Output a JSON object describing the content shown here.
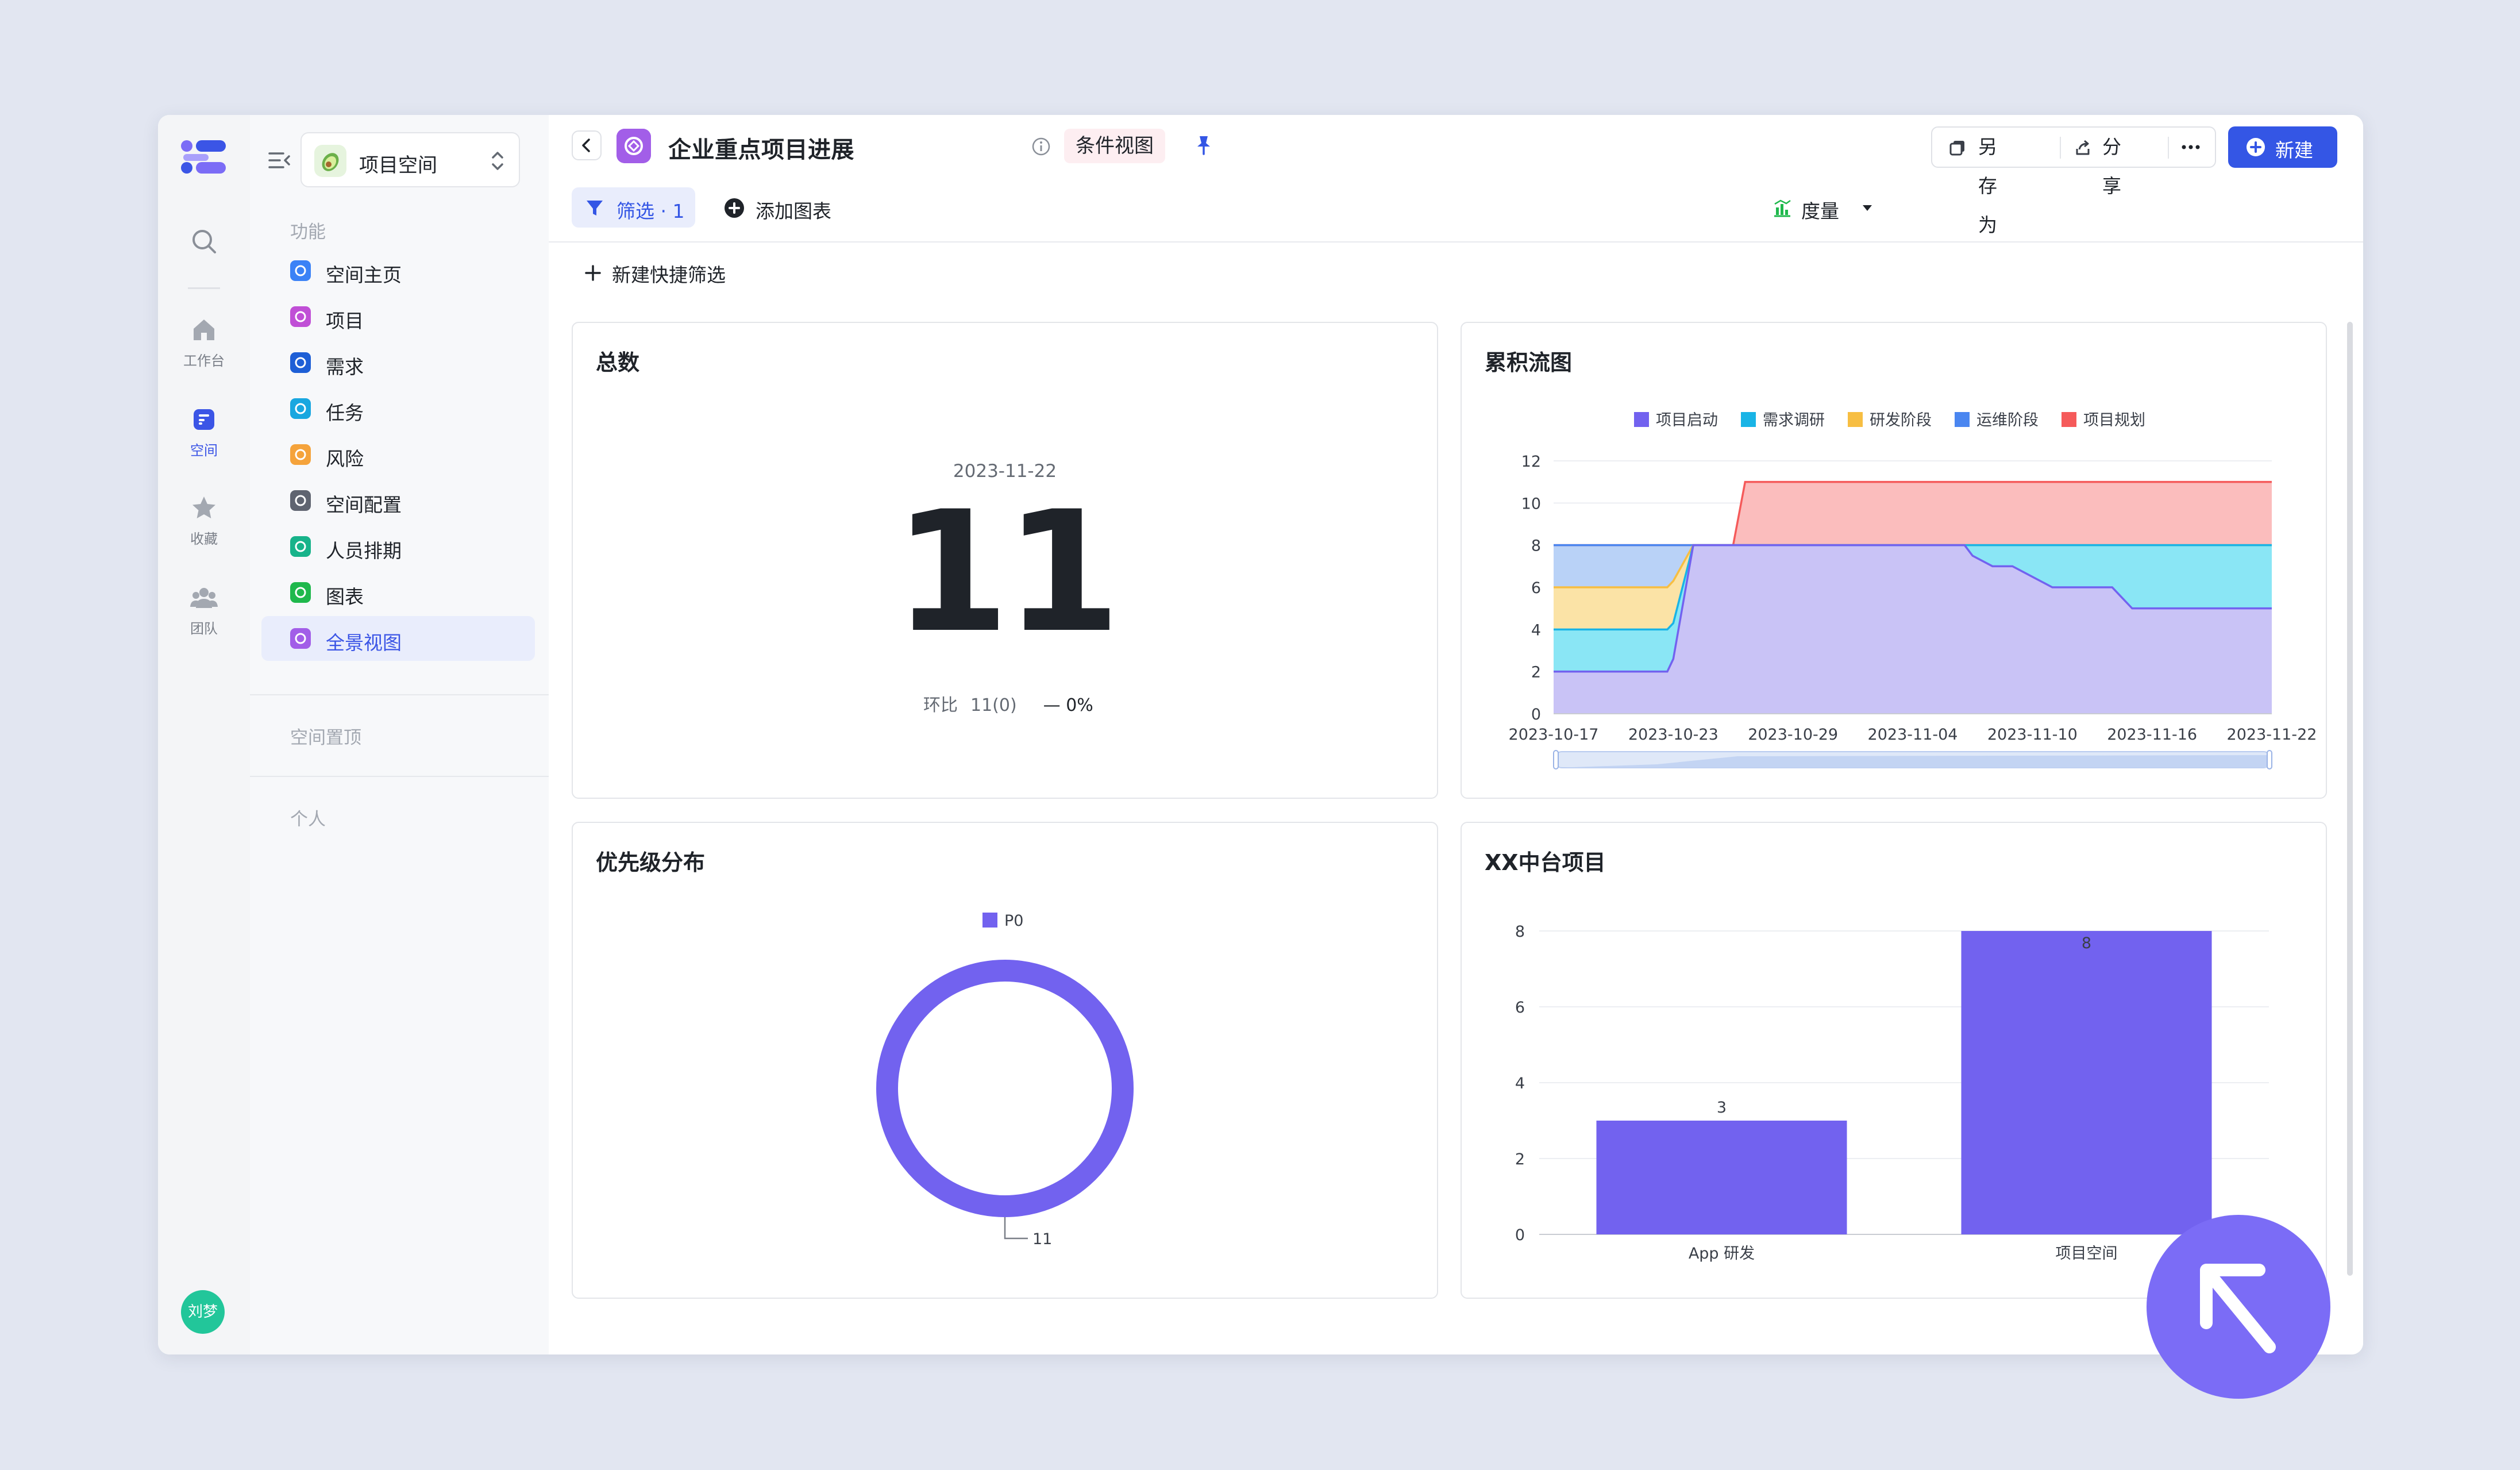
{
  "rail": {
    "items": [
      {
        "label": "工作台",
        "icon": "home-icon"
      },
      {
        "label": "空间",
        "icon": "space-icon"
      },
      {
        "label": "收藏",
        "icon": "star-icon"
      },
      {
        "label": "团队",
        "icon": "team-icon"
      }
    ],
    "active_item": "空间",
    "avatar": "刘梦"
  },
  "sidebar": {
    "space_name": "项目空间",
    "section_features": "功能",
    "items": [
      {
        "label": "空间主页",
        "color": "#3b82f6"
      },
      {
        "label": "项目",
        "color": "#c04fd6"
      },
      {
        "label": "需求",
        "color": "#1e5fd6"
      },
      {
        "label": "任务",
        "color": "#19a7e0"
      },
      {
        "label": "风险",
        "color": "#f5a33b"
      },
      {
        "label": "空间配置",
        "color": "#5f6470"
      },
      {
        "label": "人员排期",
        "color": "#17b38a"
      },
      {
        "label": "图表",
        "color": "#1fb84c"
      },
      {
        "label": "全景视图",
        "color": "#a25ee8"
      }
    ],
    "active_item": "全景视图",
    "section_pinned": "空间置顶",
    "section_personal": "个人"
  },
  "header": {
    "title": "企业重点项目进展",
    "tag": "条件视图",
    "save_as": "另存为",
    "share": "分享",
    "new": "新建"
  },
  "toolbar": {
    "filter": "筛选 · 1",
    "add_chart": "添加图表",
    "metric": "度量",
    "quick_filter": "新建快捷筛选"
  },
  "colors": {
    "accent": "#3456e5",
    "purple": "#7262ef"
  },
  "cards": {
    "total": {
      "title": "总数",
      "date": "2023-11-22",
      "value": "11",
      "ratio_label": "环比",
      "ratio_value": "11(0)",
      "ratio_percent": "— 0%"
    },
    "cfd_title": "累积流图",
    "priority_title": "优先级分布",
    "platform_title": "XX中台项目"
  },
  "chart_data": [
    {
      "type": "area",
      "title": "累积流图",
      "x_ticks": [
        "2023-10-17",
        "2023-10-23",
        "2023-10-29",
        "2023-11-04",
        "2023-11-10",
        "2023-11-16",
        "2023-11-22"
      ],
      "x_days": [
        0,
        1,
        2,
        3,
        4,
        5,
        5.7,
        6,
        7,
        8,
        9,
        9.6,
        10,
        11,
        12,
        13,
        14,
        15,
        16,
        17,
        18,
        19,
        20,
        20.6,
        21,
        22,
        23,
        24,
        25,
        26,
        27,
        28,
        29,
        30,
        31,
        32,
        33,
        34,
        35,
        36
      ],
      "ylim": [
        0,
        12
      ],
      "y_ticks": [
        0,
        2,
        4,
        6,
        8,
        10,
        12
      ],
      "legend_position": "top",
      "series_stack": [
        {
          "name": "项目启动",
          "color": "#7262ef",
          "fill": "#c9c3f6",
          "cumulative": [
            2,
            2,
            2,
            2,
            2,
            2,
            2,
            2.6,
            8,
            8,
            8,
            8,
            8,
            8,
            8,
            8,
            8,
            8,
            8,
            8,
            8,
            8,
            8,
            8,
            7.5,
            7,
            7,
            6.5,
            6,
            6,
            6,
            6,
            5,
            5,
            5,
            5,
            5,
            5,
            5,
            5
          ]
        },
        {
          "name": "需求调研",
          "color": "#19b4e6",
          "fill": "#8ae6f5",
          "cumulative": [
            4,
            4,
            4,
            4,
            4,
            4,
            4,
            4.3,
            8,
            8,
            8,
            8,
            8,
            8,
            8,
            8,
            8,
            8,
            8,
            8,
            8,
            8,
            8,
            8,
            8,
            8,
            8,
            8,
            8,
            8,
            8,
            8,
            8,
            8,
            8,
            8,
            8,
            8,
            8,
            8
          ]
        },
        {
          "name": "研发阶段",
          "color": "#f7be42",
          "fill": "#fbe3a6",
          "cumulative": [
            6,
            6,
            6,
            6,
            6,
            6,
            6,
            6.3,
            8,
            8,
            8,
            8,
            8,
            8,
            8,
            8,
            8,
            8,
            8,
            8,
            8,
            8,
            8,
            8,
            8,
            8,
            8,
            8,
            8,
            8,
            8,
            8,
            8,
            8,
            8,
            8,
            8,
            8,
            8,
            8
          ]
        },
        {
          "name": "运维阶段",
          "color": "#4a86f0",
          "fill": "#b9d2f7",
          "cumulative": [
            8,
            8,
            8,
            8,
            8,
            8,
            8,
            8,
            8,
            8,
            8,
            8,
            8,
            8,
            8,
            8,
            8,
            8,
            8,
            8,
            8,
            8,
            8,
            8,
            8,
            8,
            8,
            8,
            8,
            8,
            8,
            8,
            8,
            8,
            8,
            8,
            8,
            8,
            8,
            8
          ]
        },
        {
          "name": "项目规划",
          "color": "#f55a5a",
          "fill": "#fbbdbd",
          "cumulative": [
            8,
            8,
            8,
            8,
            8,
            8,
            8,
            8,
            8,
            8,
            8,
            11,
            11,
            11,
            11,
            11,
            11,
            11,
            11,
            11,
            11,
            11,
            11,
            11,
            11,
            11,
            11,
            11,
            11,
            11,
            11,
            11,
            11,
            11,
            11,
            11,
            11,
            11,
            11,
            11
          ]
        }
      ]
    },
    {
      "type": "pie",
      "title": "优先级分布",
      "donut": true,
      "slices": [
        {
          "name": "P0",
          "value": 11,
          "color": "#7262ef"
        }
      ],
      "legend_position": "top"
    },
    {
      "type": "bar",
      "title": "XX中台项目",
      "categories": [
        "App 研发",
        "项目空间"
      ],
      "values": [
        3,
        8
      ],
      "ylim": [
        0,
        8
      ],
      "y_ticks": [
        0,
        2,
        4,
        6,
        8
      ],
      "color": "#7262ef"
    }
  ]
}
